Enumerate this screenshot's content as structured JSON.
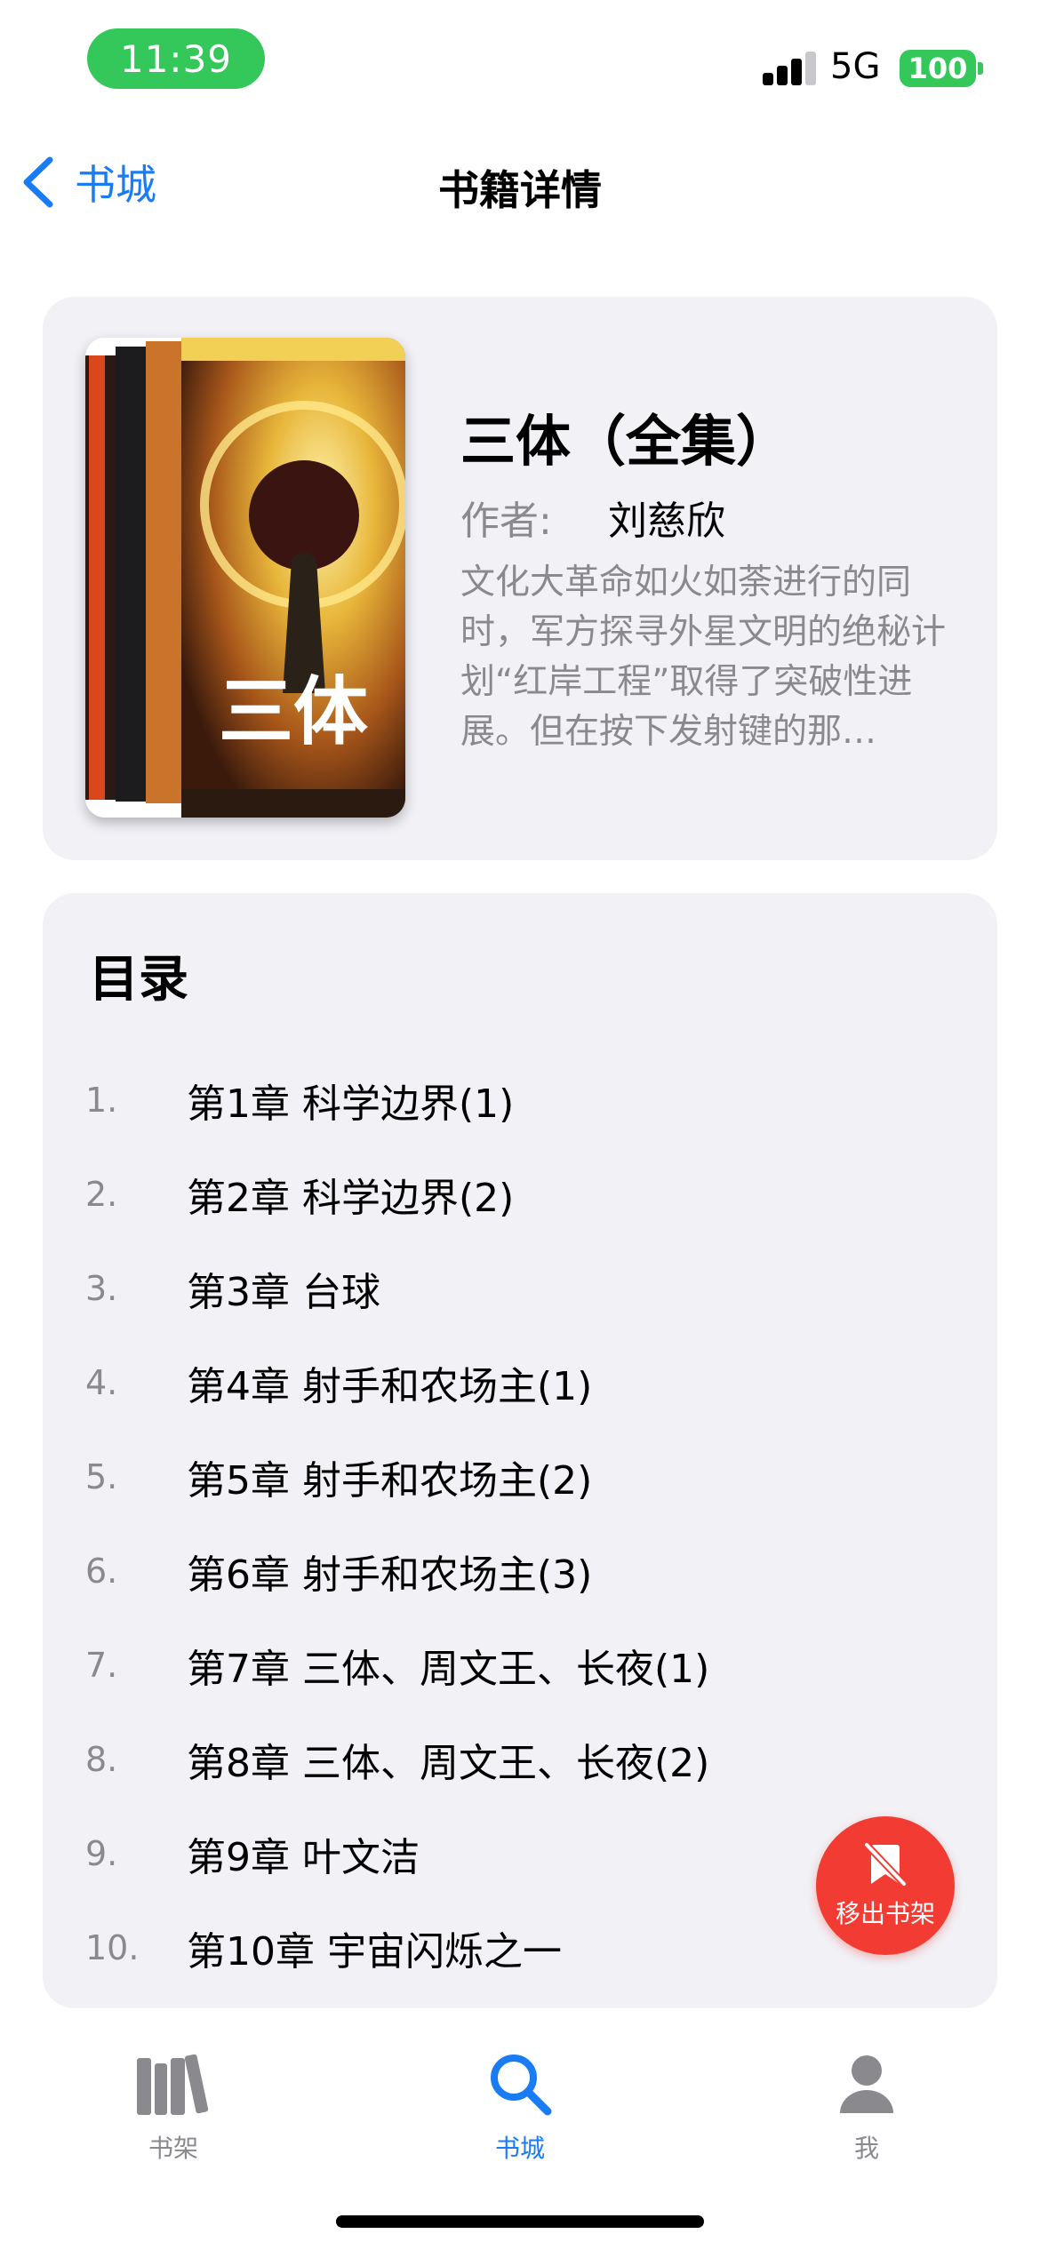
{
  "status_bar": {
    "time": "11:39",
    "network": "5G",
    "battery": "100"
  },
  "nav": {
    "back_label": "书城",
    "title": "书籍详情"
  },
  "book": {
    "cover_text": "三体",
    "title": "三体（全集）",
    "author_label": "作者:",
    "author": "刘慈欣",
    "synopsis": "文化大革命如火如荼进行的同时，军方探寻外星文明的绝秘计划“红岸工程”取得了突破性进展。但在按下发射键的那…"
  },
  "toc": {
    "title": "目录",
    "items": [
      {
        "num": "1.",
        "text": "第1章 科学边界(1)"
      },
      {
        "num": "2.",
        "text": "第2章 科学边界(2)"
      },
      {
        "num": "3.",
        "text": "第3章 台球"
      },
      {
        "num": "4.",
        "text": "第4章 射手和农场主(1)"
      },
      {
        "num": "5.",
        "text": "第5章 射手和农场主(2)"
      },
      {
        "num": "6.",
        "text": "第6章 射手和农场主(3)"
      },
      {
        "num": "7.",
        "text": "第7章 三体、周文王、长夜(1)"
      },
      {
        "num": "8.",
        "text": "第8章 三体、周文王、长夜(2)"
      },
      {
        "num": "9.",
        "text": "第9章 叶文洁"
      },
      {
        "num": "10.",
        "text": "第10章 宇宙闪烁之一"
      }
    ]
  },
  "fab": {
    "label": "移出书架",
    "icon": "bookmark-slash-icon",
    "color": "#f23b33"
  },
  "tabs": [
    {
      "label": "书架",
      "icon": "books-icon",
      "active": false
    },
    {
      "label": "书城",
      "icon": "search-icon",
      "active": true
    },
    {
      "label": "我",
      "icon": "person-icon",
      "active": false
    }
  ],
  "colors": {
    "accent": "#1a7cf5",
    "status_green": "#34c759",
    "card_bg": "#f1f1f6",
    "secondary_text": "#8a8a8e"
  }
}
